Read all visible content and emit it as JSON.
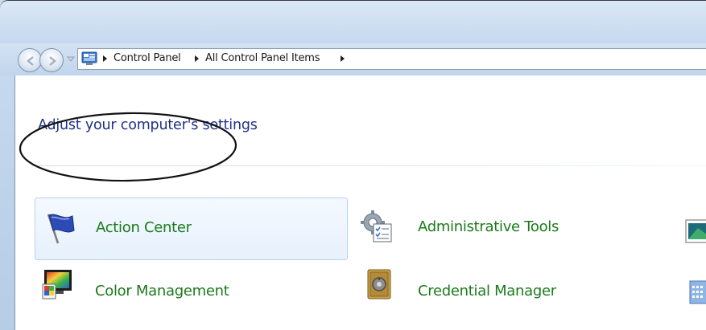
{
  "window": {
    "breadcrumb": [
      "Control Panel",
      "All Control Panel Items"
    ]
  },
  "content": {
    "heading": "Adjust your computer's settings",
    "items": [
      {
        "label": "Action Center",
        "icon": "action-center-flag-icon",
        "selected": true
      },
      {
        "label": "Administrative Tools",
        "icon": "administrative-tools-icon"
      },
      {
        "label": "Color Management",
        "icon": "color-management-icon"
      },
      {
        "label": "Credential Manager",
        "icon": "credential-manager-icon"
      }
    ]
  },
  "colors": {
    "heading": "#1e3287",
    "link": "#1b7a1b",
    "selection": "#e7f1fc"
  }
}
